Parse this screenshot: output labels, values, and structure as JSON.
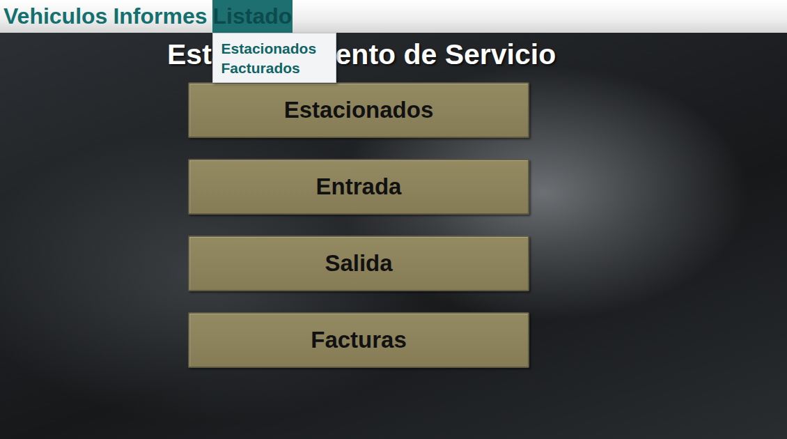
{
  "menu_bar": {
    "items": [
      {
        "label": "Vehiculos",
        "selected": false,
        "expanded": false,
        "dropdown": []
      },
      {
        "label": "Informes",
        "selected": false,
        "expanded": false,
        "dropdown": []
      },
      {
        "label": "Listado",
        "selected": true,
        "expanded": true,
        "dropdown": [
          "Estacionados",
          "Facturados"
        ]
      }
    ]
  },
  "title": "Estacionamiento de Servicio",
  "buttons": [
    "Estacionados",
    "Entrada",
    "Salida",
    "Facturas"
  ]
}
